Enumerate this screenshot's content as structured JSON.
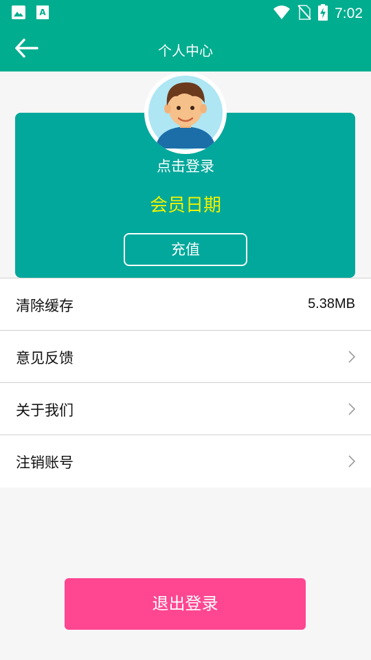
{
  "status_bar": {
    "time": "7:02",
    "icons": [
      "image-icon",
      "text-icon",
      "wifi-icon",
      "no-sim-icon",
      "battery-charging-icon"
    ]
  },
  "header": {
    "title": "个人中心",
    "back_icon": "back-arrow-icon"
  },
  "profile": {
    "login_text": "点击登录",
    "member_date": "会员日期",
    "recharge_label": "充值"
  },
  "menu": {
    "items": [
      {
        "label": "清除缓存",
        "value": "5.38MB"
      },
      {
        "label": "意见反馈",
        "icon": "chevron-right-icon"
      },
      {
        "label": "关于我们",
        "icon": "chevron-right-icon"
      },
      {
        "label": "注销账号",
        "icon": "chevron-right-icon"
      }
    ]
  },
  "logout": {
    "label": "退出登录"
  },
  "colors": {
    "primary": "#01ad8f",
    "card": "#01a89b",
    "member_date": "#f2f200",
    "logout": "#fe4691",
    "background": "#f6f6f6"
  }
}
